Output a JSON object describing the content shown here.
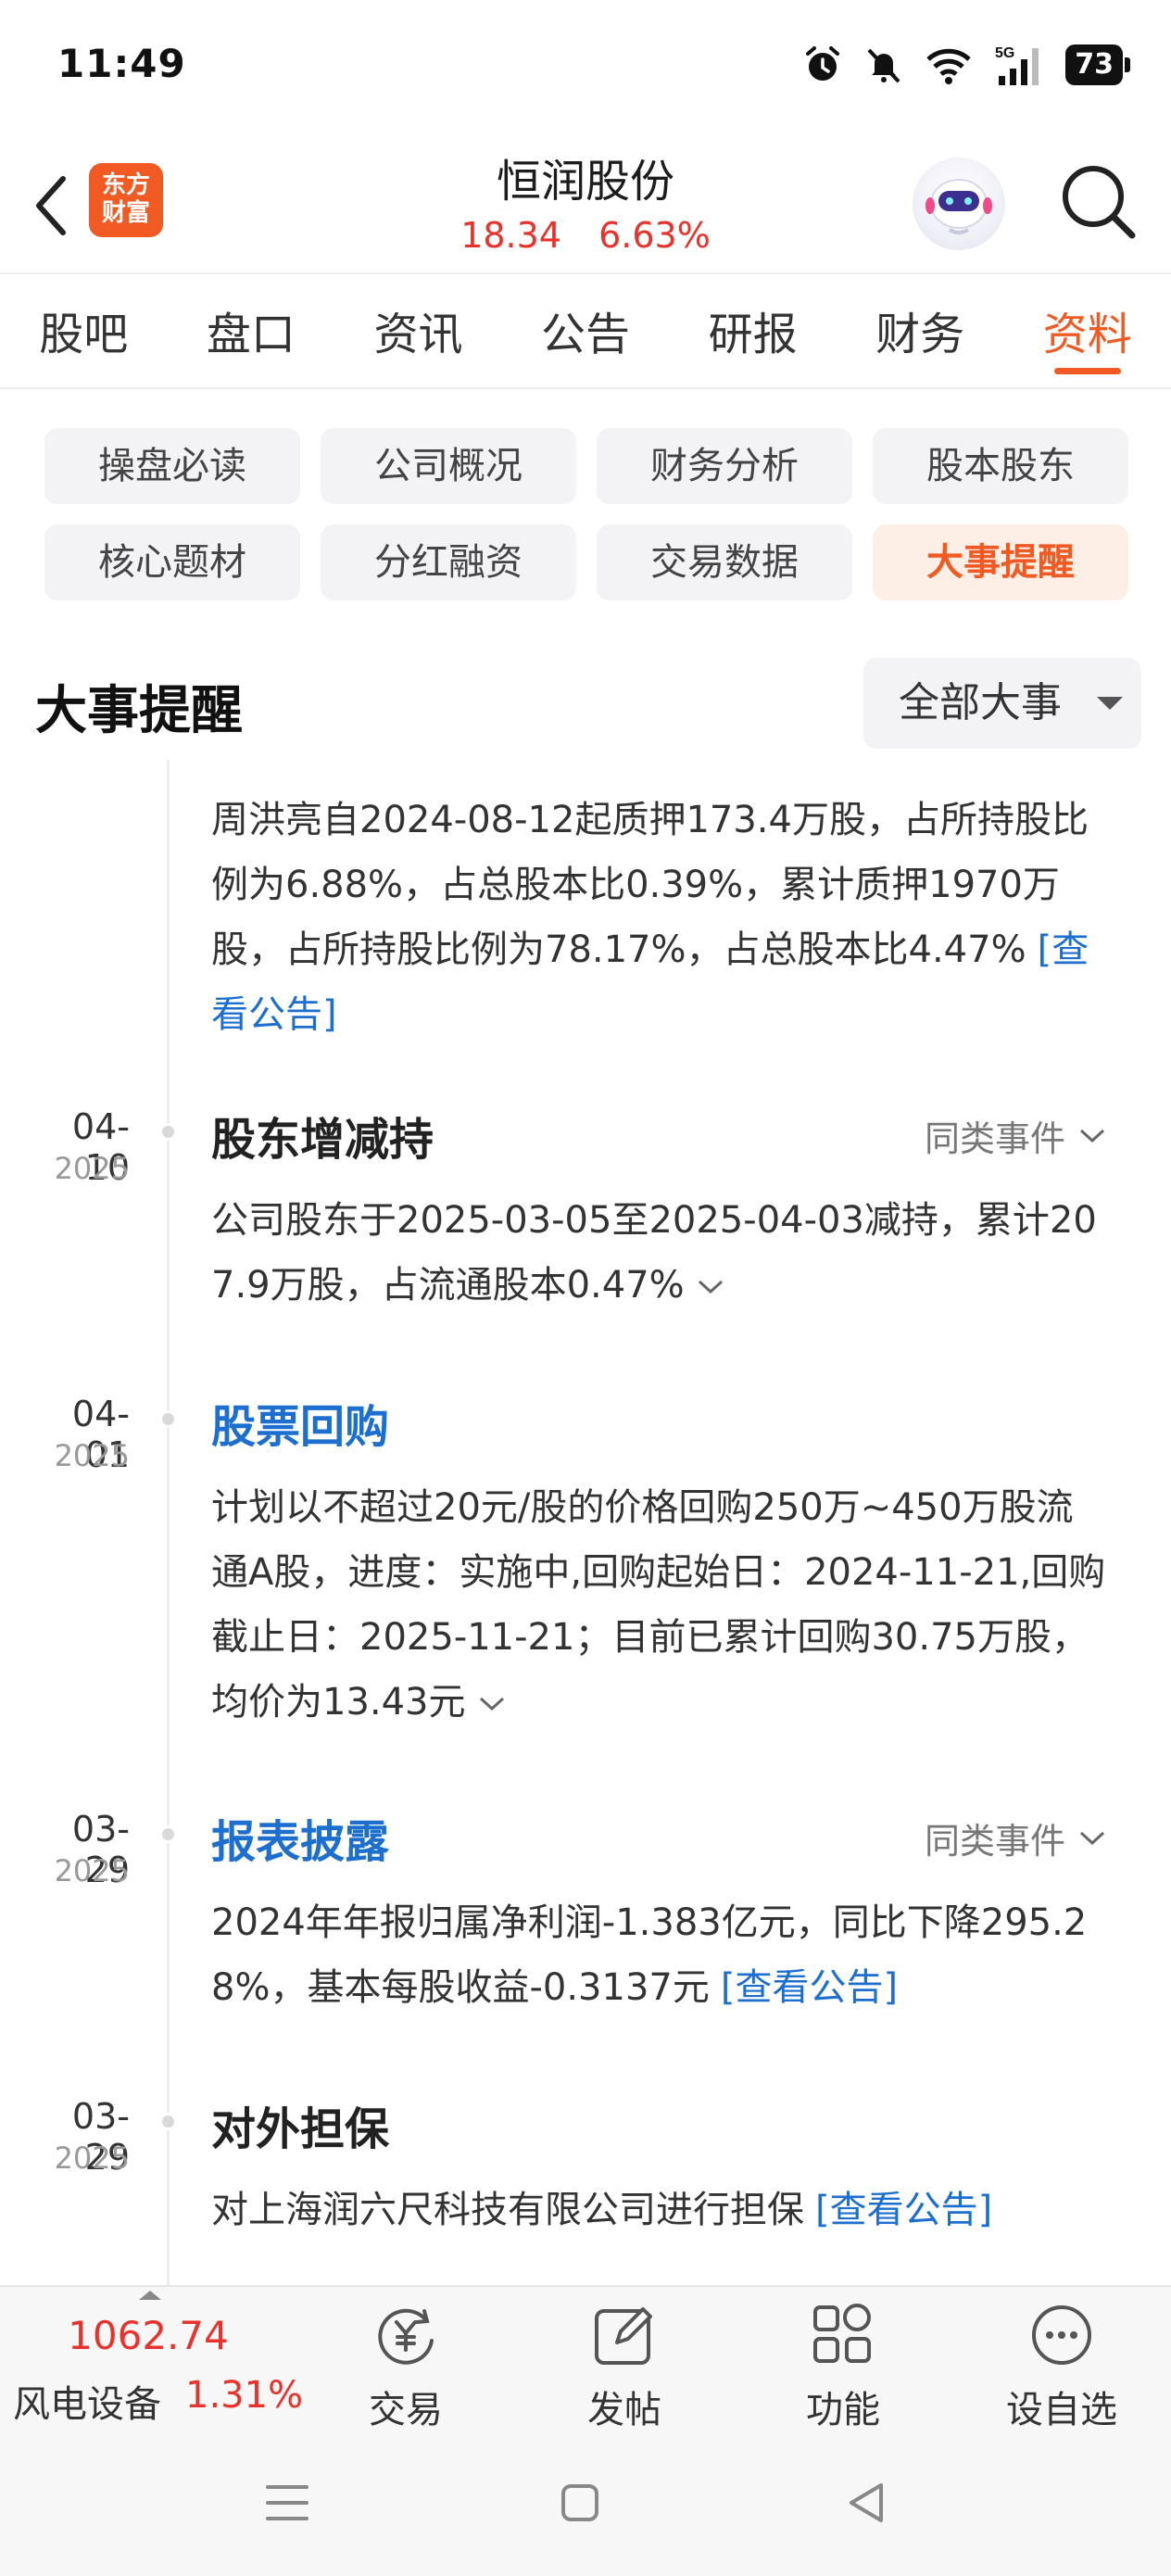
{
  "status_bar": {
    "time": "11:49",
    "battery": "73",
    "network": "5G"
  },
  "header": {
    "logo_text": "东方财富",
    "title": "恒润股份",
    "price": "18.34",
    "change": "6.63%",
    "accent_color": "#f15a22",
    "up_color": "#e8322b"
  },
  "tabs": [
    {
      "label": "股吧"
    },
    {
      "label": "盘口"
    },
    {
      "label": "资讯"
    },
    {
      "label": "公告"
    },
    {
      "label": "研报"
    },
    {
      "label": "财务"
    },
    {
      "label": "资料",
      "active": true
    }
  ],
  "submenu": [
    {
      "label": "操盘必读"
    },
    {
      "label": "公司概况"
    },
    {
      "label": "财务分析"
    },
    {
      "label": "股本股东"
    },
    {
      "label": "核心题材"
    },
    {
      "label": "分红融资"
    },
    {
      "label": "交易数据"
    },
    {
      "label": "大事提醒",
      "active": true
    }
  ],
  "section": {
    "title": "大事提醒",
    "filter_label": "全部大事"
  },
  "timeline": {
    "partial_item": {
      "text": "周洪亮自2024-08-12起质押173.4万股，占所持股比例为6.88%，占总股本比0.39%，累计质押1970万股，占所持股比例为78.17%，占总股本比4.47%",
      "link": "[查看公告]"
    },
    "items": [
      {
        "date": "04-10",
        "year": "2025",
        "title": "股东增减持",
        "similar": "同类事件",
        "text": "公司股东于2025-03-05至2025-04-03减持，累计207.9万股，占流通股本0.47%"
      },
      {
        "date": "04-01",
        "year": "2025",
        "title": "股票回购",
        "text": "计划以不超过20元/股的价格回购250万~450万股流通A股，进度：实施中,回购起始日：2024-11-21,回购截止日：2025-11-21；目前已累计回购30.75万股，均价为13.43元"
      },
      {
        "date": "03-29",
        "year": "2025",
        "title": "报表披露",
        "similar": "同类事件",
        "text": "2024年年报归属净利润-1.383亿元，同比下降295.28%，基本每股收益-0.3137元",
        "link": "[查看公告]"
      },
      {
        "date": "03-29",
        "year": "2025",
        "title": "对外担保",
        "text": "对上海润六尺科技有限公司进行担保",
        "link": "[查看公告]"
      }
    ]
  },
  "bottom_bar": {
    "index_value": "1062.74",
    "index_name": "风电设备",
    "index_change": "1.31%",
    "trade_label": "交易",
    "post_label": "发帖",
    "functions_label": "功能",
    "watchlist_label": "设自选"
  }
}
